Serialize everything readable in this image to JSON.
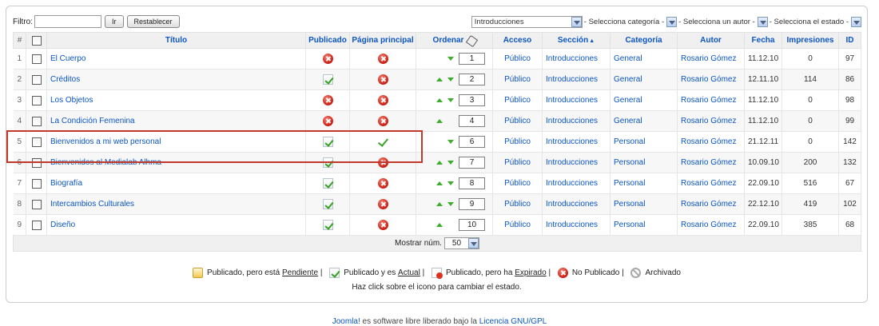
{
  "filter": {
    "label": "Filtro:",
    "value": "",
    "go_button": "Ir",
    "reset_button": "Restablecer"
  },
  "selects": {
    "section": "Introducciones",
    "category": "- Selecciona categoría -",
    "author": "- Selecciona un autor -",
    "state": "- Selecciona el estado -"
  },
  "headers": {
    "num": "#",
    "title": "Título",
    "published": "Publicado",
    "frontpage": "Página principal",
    "order": "Ordenar",
    "access": "Acceso",
    "section": "Sección",
    "category": "Categoría",
    "author": "Autor",
    "date": "Fecha",
    "hits": "Impresiones",
    "id": "ID"
  },
  "rows": [
    {
      "num": "1",
      "title": "El Cuerpo",
      "published": "no",
      "frontpage": "no",
      "up": false,
      "down": true,
      "order": "1",
      "access": "Público",
      "section": "Introducciones",
      "category": "General",
      "author": "Rosario Gómez",
      "date": "11.12.10",
      "hits": "0",
      "id": "97"
    },
    {
      "num": "2",
      "title": "Créditos",
      "published": "yes",
      "frontpage": "no",
      "up": true,
      "down": true,
      "order": "2",
      "access": "Público",
      "section": "Introducciones",
      "category": "General",
      "author": "Rosario Gómez",
      "date": "12.11.10",
      "hits": "114",
      "id": "86"
    },
    {
      "num": "3",
      "title": "Los Objetos",
      "published": "no",
      "frontpage": "no",
      "up": true,
      "down": true,
      "order": "3",
      "access": "Público",
      "section": "Introducciones",
      "category": "General",
      "author": "Rosario Gómez",
      "date": "11.12.10",
      "hits": "0",
      "id": "98"
    },
    {
      "num": "4",
      "title": "La Condición Femenina",
      "published": "no",
      "frontpage": "no",
      "up": true,
      "down": false,
      "order": "4",
      "access": "Público",
      "section": "Introducciones",
      "category": "General",
      "author": "Rosario Gómez",
      "date": "11.12.10",
      "hits": "0",
      "id": "99"
    },
    {
      "num": "5",
      "title": "Bienvenidos a mi web personal",
      "published": "yes",
      "frontpage": "yes",
      "up": false,
      "down": true,
      "order": "6",
      "access": "Público",
      "section": "Introducciones",
      "category": "Personal",
      "author": "Rosario Gómez",
      "date": "21.12.11",
      "hits": "0",
      "id": "142"
    },
    {
      "num": "6",
      "title": "Bienvenidos al Medialab Alhma",
      "published": "yes",
      "frontpage": "no",
      "up": true,
      "down": true,
      "order": "7",
      "access": "Público",
      "section": "Introducciones",
      "category": "Personal",
      "author": "Rosario Gómez",
      "date": "10.09.10",
      "hits": "200",
      "id": "132"
    },
    {
      "num": "7",
      "title": "Biografía",
      "published": "yes",
      "frontpage": "no",
      "up": true,
      "down": true,
      "order": "8",
      "access": "Público",
      "section": "Introducciones",
      "category": "Personal",
      "author": "Rosario Gómez",
      "date": "22.09.10",
      "hits": "516",
      "id": "67"
    },
    {
      "num": "8",
      "title": "Intercambios Culturales",
      "published": "yes",
      "frontpage": "no",
      "up": true,
      "down": true,
      "order": "9",
      "access": "Público",
      "section": "Introducciones",
      "category": "Personal",
      "author": "Rosario Gómez",
      "date": "22.12.10",
      "hits": "419",
      "id": "102"
    },
    {
      "num": "9",
      "title": "Diseño",
      "published": "yes",
      "frontpage": "no",
      "up": true,
      "down": false,
      "order": "10",
      "access": "Público",
      "section": "Introducciones",
      "category": "Personal",
      "author": "Rosario Gómez",
      "date": "22.09.10",
      "hits": "385",
      "id": "68"
    }
  ],
  "pagination": {
    "label": "Mostrar núm.",
    "value": "50"
  },
  "legend": {
    "pending_prefix": "Publicado, pero está ",
    "pending_link": "Pendiente",
    "current_prefix": "Publicado y es ",
    "current_link": "Actual",
    "expired_prefix": "Publicado, pero ha ",
    "expired_link": "Expirado",
    "unpublished": "No Publicado",
    "archived": "Archivado",
    "separator": "|"
  },
  "hint": "Haz click sobre el icono para cambiar el estado.",
  "footer": {
    "link1": "Joomla!",
    "middle": " es software libre liberado bajo la ",
    "link2": "Licencia GNU/GPL"
  },
  "colors": {
    "link": "#0b55c4",
    "highlight": "#c0392b",
    "published_green": "#35a01f",
    "unpublished_red": "#d0261a"
  }
}
